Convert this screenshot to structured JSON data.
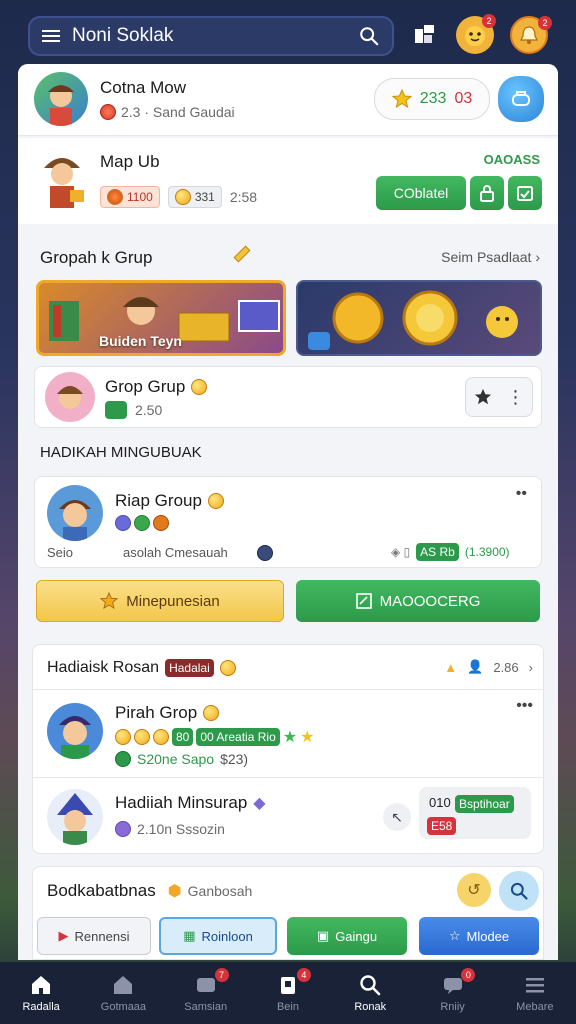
{
  "topbar": {
    "search_title": "Noni Soklak",
    "badge_1": "2",
    "badge_2": "2"
  },
  "profile": {
    "name": "Cotna Mow",
    "sub": "2.3 · Sand Gaudai",
    "stars": "233",
    "stars_extra": "03"
  },
  "map": {
    "name": "Map Ub",
    "gold": "1100",
    "silver": "331",
    "time": "2:58",
    "tag": "OAOASS",
    "button": "COblatel"
  },
  "groups": {
    "title": "Gropah k Grup",
    "link": "Seim Psadlaat",
    "banner_left": "Buiden Teyn",
    "group_name": "Grop Grup",
    "group_value": "2.50"
  },
  "section_title": "HADIKAH MINGUBUAK",
  "riap": {
    "name": "Riap Group",
    "foot_left": "Seio",
    "foot_mid": "asolah Cmesauah",
    "badge_green": "AS Rb",
    "badge_amount": "(1.3900)",
    "btn_yellow": "Minepunesian",
    "btn_green": "MAOOOCERG"
  },
  "rosan": {
    "title": "Hadiaisk Rosan",
    "tag": "Hadalai",
    "right": "2.86",
    "item1_name": "Pirah Grop",
    "item1_chip1": "80",
    "item1_chip2": "00 Areatia Rio",
    "item1_sub": "S20ne Sapo",
    "item1_price": "$23)",
    "item2_name": "Hadiiah Minsurap",
    "item2_sub": "2.10n Sssozin",
    "item2_tag1": "Bsptihoar",
    "item2_tag2": "E58",
    "item2_num": "010"
  },
  "bottom_card": {
    "title": "Bodkabatbnas",
    "sub": "Ganbosah",
    "btn1": "Rennensi",
    "btn2": "Roinloon",
    "btn3": "Gaingu",
    "btn4": "Mlodee"
  },
  "nav": {
    "items": [
      {
        "label": "Radalla",
        "icon": "home-icon"
      },
      {
        "label": "Gotmaaa",
        "icon": "house-icon"
      },
      {
        "label": "Samsian",
        "icon": "grid-icon"
      },
      {
        "label": "Bein",
        "icon": "bag-icon"
      },
      {
        "label": "Ronak",
        "icon": "search-icon"
      },
      {
        "label": "Rniiy",
        "icon": "chat-icon"
      },
      {
        "label": "Mebare",
        "icon": "menu-icon"
      }
    ],
    "badge_a": "7",
    "badge_b": "4",
    "badge_c": "0"
  },
  "colors": {
    "accent_green": "#2c9a4a",
    "accent_blue": "#3aa0e8",
    "accent_yellow": "#f6c94a",
    "nav_bg": "#1a2238"
  }
}
